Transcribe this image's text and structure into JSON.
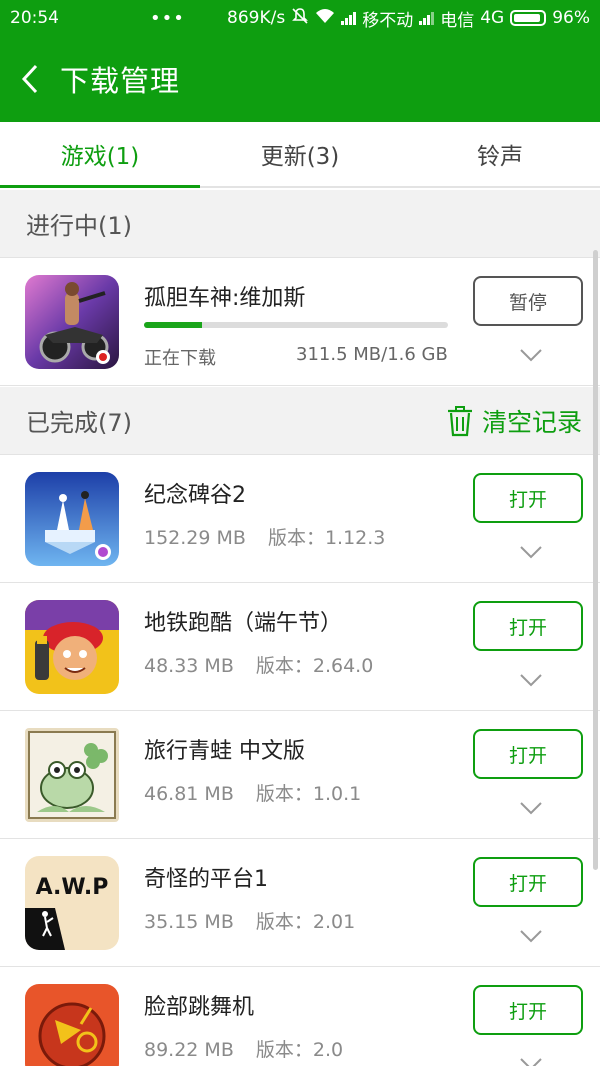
{
  "status_bar": {
    "time": "20:54",
    "dots": "•••",
    "speed": "869K/s",
    "carrier1": "移不动",
    "carrier2": "电信",
    "network": "4G",
    "battery": "96%"
  },
  "header": {
    "title": "下载管理",
    "back_icon": "back-arrow-icon"
  },
  "tabs": [
    {
      "label": "游戏(1)",
      "active": true
    },
    {
      "label": "更新(3)",
      "active": false
    },
    {
      "label": "铃声",
      "active": false
    }
  ],
  "in_progress": {
    "title": "进行中(1)",
    "item": {
      "name": "孤胆车神:维加斯",
      "status": "正在下载",
      "size": "311.5 MB/1.6 GB",
      "progress": 0.19,
      "button": "暂停"
    }
  },
  "completed": {
    "title": "已完成(7)",
    "clear_label": "清空记录",
    "items": [
      {
        "name": "纪念碑谷2",
        "size": "152.29 MB",
        "version": "版本：1.12.3",
        "button": "打开",
        "icon": "monument-valley-icon"
      },
      {
        "name": "地铁跑酷（端午节）",
        "size": "48.33 MB",
        "version": "版本：2.64.0",
        "button": "打开",
        "icon": "subway-surfers-icon"
      },
      {
        "name": "旅行青蛙  中文版",
        "size": "46.81 MB",
        "version": "版本：1.0.1",
        "button": "打开",
        "icon": "travel-frog-icon"
      },
      {
        "name": "奇怪的平台1",
        "size": "35.15 MB",
        "version": "版本：2.01",
        "button": "打开",
        "icon": "awp-icon"
      },
      {
        "name": "脸部跳舞机",
        "size": "89.22 MB",
        "version": "版本：2.0",
        "button": "打开",
        "icon": "face-dance-icon"
      }
    ]
  },
  "colors": {
    "primary": "#0e9e10",
    "section_bg": "#f2f2f2"
  }
}
